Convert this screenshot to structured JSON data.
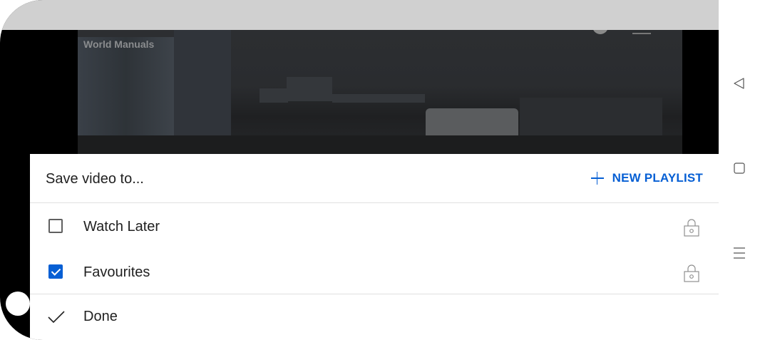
{
  "video": {
    "channel_name": "World Manuals"
  },
  "save_sheet": {
    "title": "Save video to...",
    "new_playlist_label": "NEW PLAYLIST",
    "playlists": [
      {
        "label": "Watch Later",
        "checked": false,
        "privacy_icon": "lock-icon"
      },
      {
        "label": "Favourites",
        "checked": true,
        "privacy_icon": "lock-icon"
      }
    ],
    "done_label": "Done"
  },
  "nav_bar": {
    "buttons": [
      "back-icon",
      "home-icon",
      "recents-icon"
    ]
  },
  "colors": {
    "accent": "#065fd4",
    "status_bar": "#d0d0d0",
    "text": "#212121"
  }
}
